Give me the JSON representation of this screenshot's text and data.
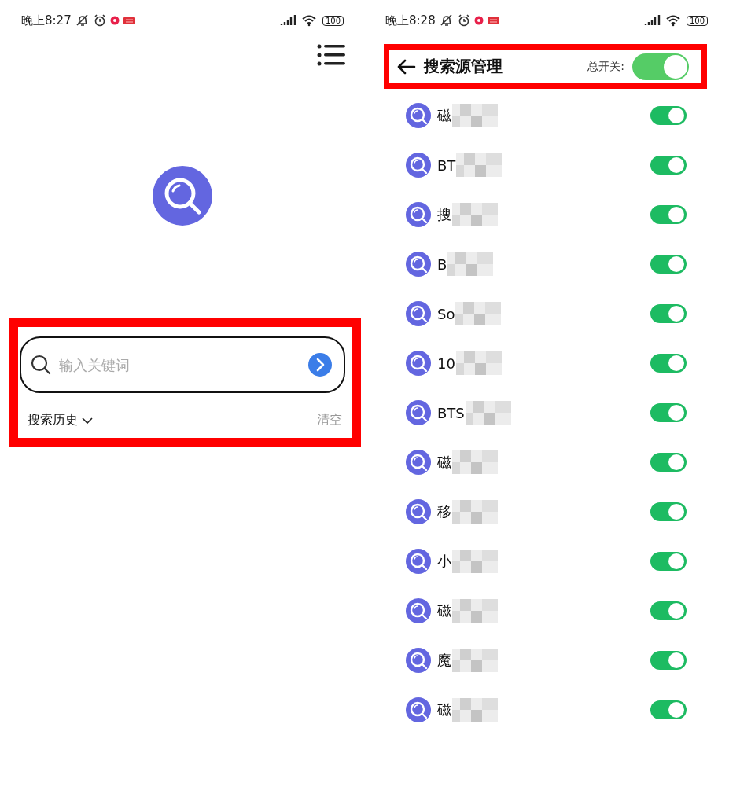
{
  "left_screen": {
    "status_bar": {
      "time": "晚上8:27",
      "battery": "100"
    },
    "search": {
      "placeholder": "输入关键词"
    },
    "history": {
      "label": "搜索历史",
      "expanded": false,
      "clear": "清空"
    }
  },
  "right_screen": {
    "status_bar": {
      "time": "晚上8:28",
      "battery": "100"
    },
    "header": {
      "title": "搜索源管理",
      "master_switch": {
        "label": "总开关:",
        "on": true
      }
    },
    "sources": [
      {
        "name": "磁",
        "on": true
      },
      {
        "name": "BT",
        "on": true
      },
      {
        "name": "搜",
        "on": true
      },
      {
        "name": "B",
        "on": true
      },
      {
        "name": "So",
        "on": true
      },
      {
        "name": "10",
        "on": true
      },
      {
        "name": "BTS",
        "on": true
      },
      {
        "name": "磁",
        "on": true
      },
      {
        "name": "移",
        "on": true
      },
      {
        "name": "小",
        "on": true
      },
      {
        "name": "磁",
        "on": true
      },
      {
        "name": "魔",
        "on": true
      },
      {
        "name": "磁",
        "on": true
      }
    ]
  }
}
